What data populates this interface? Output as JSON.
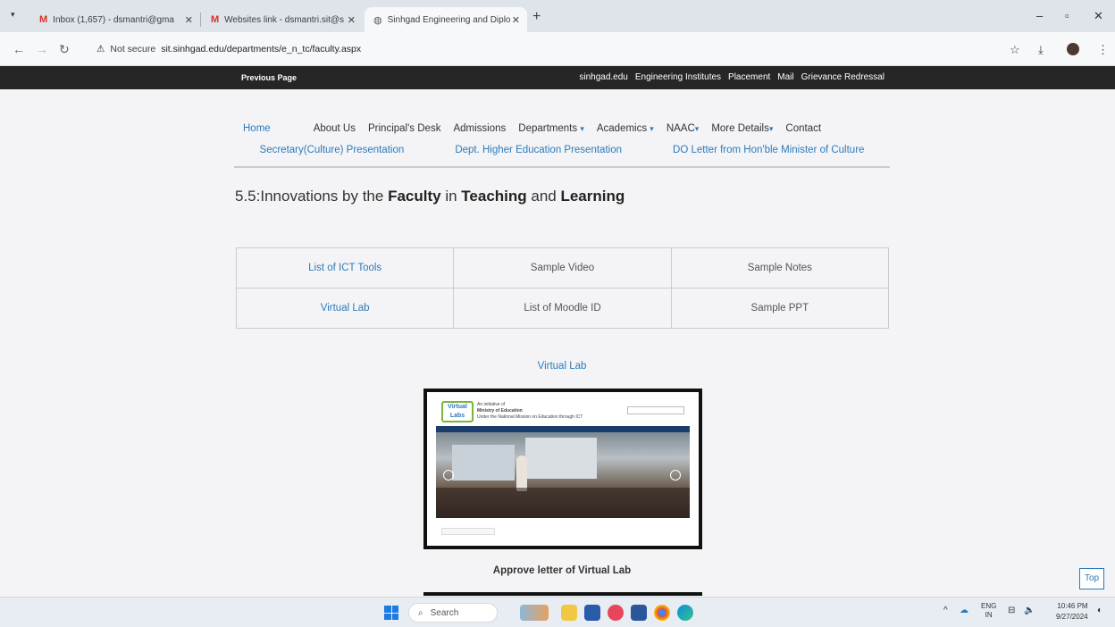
{
  "browser": {
    "tabs": [
      {
        "title": "Inbox (1,657) - dsmantri@gma",
        "icon": "gmail-icon"
      },
      {
        "title": "Websites link - dsmantri.sit@s",
        "icon": "gmail-icon"
      },
      {
        "title": "Sinhgad Engineering and Diplo",
        "icon": "globe-icon"
      }
    ],
    "new_tab": "+",
    "security_label": "Not secure",
    "url": "sit.sinhgad.edu/departments/e_n_tc/faculty.aspx"
  },
  "site": {
    "previous_page": "Previous Page",
    "top_links": [
      "sinhgad.edu",
      "Engineering Institutes",
      "Placement",
      "Mail",
      "Grievance Redressal"
    ],
    "nav": {
      "home": "Home",
      "items": [
        {
          "label": "About Us",
          "caret": ""
        },
        {
          "label": "Principal's Desk",
          "caret": ""
        },
        {
          "label": "Admissions",
          "caret": ""
        },
        {
          "label": "Departments",
          "caret": "▾"
        },
        {
          "label": "Academics",
          "caret": "▾"
        },
        {
          "label": "NAAC",
          "caret": "▾"
        },
        {
          "label": "More Details",
          "caret": "▾"
        },
        {
          "label": "Contact",
          "caret": ""
        }
      ]
    },
    "sub_nav": [
      "Secretary(Culture) Presentation",
      "Dept. Higher Education Presentation",
      "DO Letter from Hon'ble Minister of Culture"
    ],
    "heading": {
      "prefix": "5.5:Innovations by the ",
      "w1": "Faculty",
      "mid1": " in ",
      "w2": "Teaching",
      "mid2": " and ",
      "w3": "Learning"
    },
    "ict_table": [
      [
        "List of ICT Tools",
        "Sample Video",
        "Sample Notes"
      ],
      [
        "Virtual Lab",
        "List of Moodle ID",
        "Sample PPT"
      ]
    ],
    "virtual_lab_title": "Virtual Lab",
    "vl_screenshot": {
      "logo": "Virtual Labs",
      "line1": "An initiative of",
      "line2": "Ministry of Education",
      "line3": "Under the National Mission on Education through ICT"
    },
    "approve_caption": "Approve letter of Virtual Lab",
    "top_button": "Top"
  },
  "taskbar": {
    "search_placeholder": "Search",
    "lang_top": "ENG",
    "lang_bottom": "IN",
    "time": "10:46 PM",
    "date": "9/27/2024"
  },
  "colors": {
    "link": "#2b7bb9",
    "top_strip": "#262626"
  }
}
